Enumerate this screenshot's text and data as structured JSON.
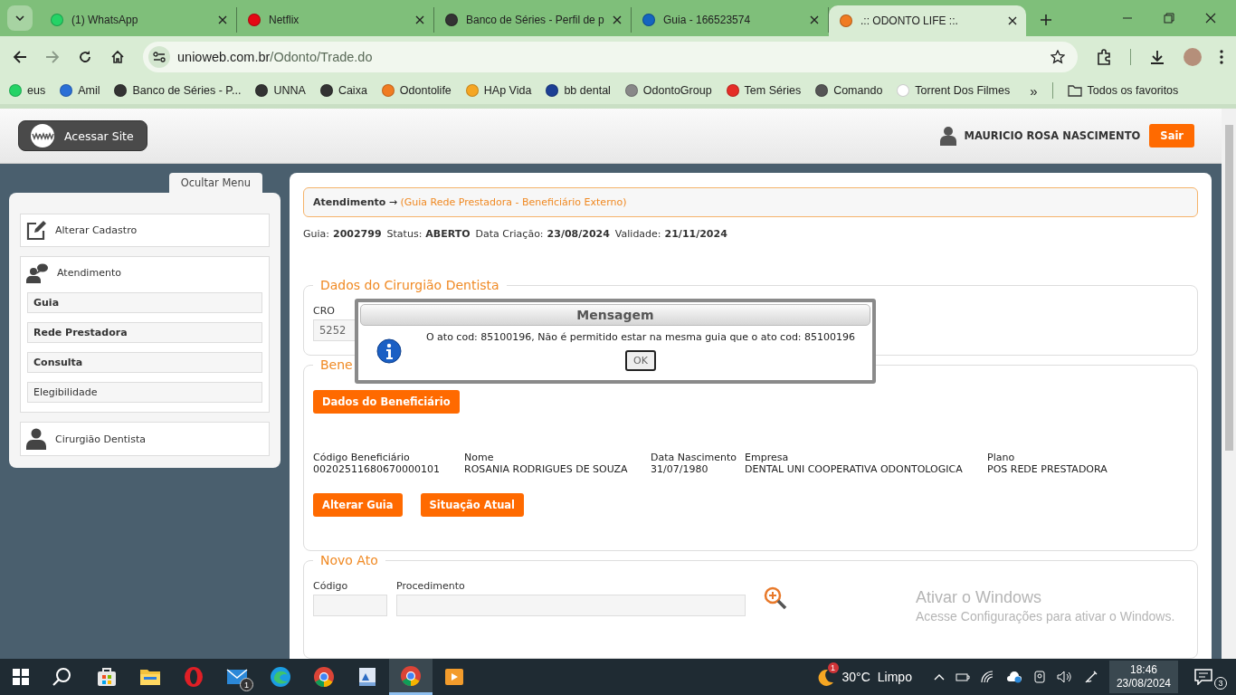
{
  "browser": {
    "tabs": [
      {
        "title": "(1) WhatsApp",
        "selected": false,
        "color": "#25d366"
      },
      {
        "title": "Netflix",
        "selected": false,
        "color": "#e50914"
      },
      {
        "title": "Banco de Séries - Perfil de p",
        "selected": false,
        "color": "#333333"
      },
      {
        "title": "Guia - 166523574",
        "selected": false,
        "color": "#1565c0"
      },
      {
        "title": ".:: ODONTO LIFE ::.",
        "selected": true,
        "color": "#f07c22"
      }
    ],
    "address": {
      "domain": "unioweb.com.br",
      "path": "/Odonto/Trade.do"
    },
    "bookmarks": [
      {
        "label": "eus",
        "color": "#25d366"
      },
      {
        "label": "Amil",
        "color": "#2a6fd6"
      },
      {
        "label": "Banco de Séries - P...",
        "color": "#333333"
      },
      {
        "label": "UNNA",
        "color": "#333333"
      },
      {
        "label": "Caixa",
        "color": "#333333"
      },
      {
        "label": "Odontolife",
        "color": "#f07c22"
      },
      {
        "label": "HAp Vida",
        "color": "#f5a623"
      },
      {
        "label": "bb dental",
        "color": "#1c3f94"
      },
      {
        "label": "OdontoGroup",
        "color": "#888888"
      },
      {
        "label": "Tem Séries",
        "color": "#e52d27"
      },
      {
        "label": "Comando",
        "color": "#555555"
      },
      {
        "label": "Torrent Dos Filmes",
        "color": "#ffffff"
      }
    ],
    "more": "»",
    "all_bookmarks": "Todos os favoritos"
  },
  "header": {
    "site_button": "Acessar Site",
    "user": "MAURICIO ROSA NASCIMENTO",
    "logout": "Sair"
  },
  "sidebar": {
    "toggle": "Ocultar Menu",
    "items": [
      {
        "label": "Alterar Cadastro",
        "kind": "edit"
      },
      {
        "label": "Atendimento",
        "kind": "chat",
        "children": [
          {
            "label": "Guia",
            "bold": true
          },
          {
            "label": "Rede Prestadora",
            "bold": true
          },
          {
            "label": "Consulta",
            "bold": true
          },
          {
            "label": "Elegibilidade",
            "bold": false
          }
        ]
      },
      {
        "label": "Cirurgião Dentista",
        "kind": "person"
      }
    ]
  },
  "breadcrumb": {
    "section": "Atendimento",
    "arrow": "→",
    "page": "(Guia Rede Prestadora - Beneficiário Externo)"
  },
  "guide_info": [
    {
      "label": "Guia:",
      "value": "2002799"
    },
    {
      "label": "Status:",
      "value": "ABERTO"
    },
    {
      "label": "Data Criação:",
      "value": "23/08/2024"
    },
    {
      "label": "Validade:",
      "value": "21/11/2024"
    }
  ],
  "dentist": {
    "legend": "Dados do Cirurgião Dentista",
    "cro_label": "CRO",
    "cro_value": "5252"
  },
  "beneficiary": {
    "legend": "Bene",
    "button": "Dados do Beneficiário",
    "fields": [
      {
        "label": "Código Beneficiário",
        "value": "00202511680670000101"
      },
      {
        "label": "Nome",
        "value": "ROSANIA RODRIGUES DE SOUZA"
      },
      {
        "label": "Data Nascimento",
        "value": "31/07/1980"
      },
      {
        "label": "Empresa",
        "value": "DENTAL UNI COOPERATIVA ODONTOLOGICA"
      },
      {
        "label": "Plano",
        "value": "POS REDE PRESTADORA"
      }
    ],
    "actions": [
      "Alterar Guia",
      "Situação Atual"
    ]
  },
  "new_act": {
    "legend": "Novo Ato",
    "fields": [
      {
        "label": "Código"
      },
      {
        "label": "Procedimento"
      }
    ]
  },
  "dialog": {
    "title": "Mensagem",
    "message": "O ato cod: 85100196, Não é permitido estar na mesma guia que o ato cod: 85100196",
    "button": "OK"
  },
  "activation": {
    "title": "Ativar o Windows",
    "text": "Acesse Configurações para ativar o Windows."
  },
  "taskbar": {
    "apps": [
      {
        "kind": "store",
        "selected": false
      },
      {
        "kind": "folder",
        "selected": false
      },
      {
        "kind": "opera",
        "selected": false
      },
      {
        "kind": "mail",
        "selected": false,
        "badge": "1"
      },
      {
        "kind": "edge",
        "selected": false
      },
      {
        "kind": "chrome",
        "selected": false
      },
      {
        "kind": "document",
        "selected": false
      },
      {
        "kind": "chrome",
        "selected": true
      },
      {
        "kind": "video",
        "selected": false
      }
    ],
    "weather": {
      "badge": "1",
      "temp": "30°C",
      "condition": "Limpo"
    },
    "time": "18:46",
    "date": "23/08/2024",
    "notifications": "3"
  }
}
